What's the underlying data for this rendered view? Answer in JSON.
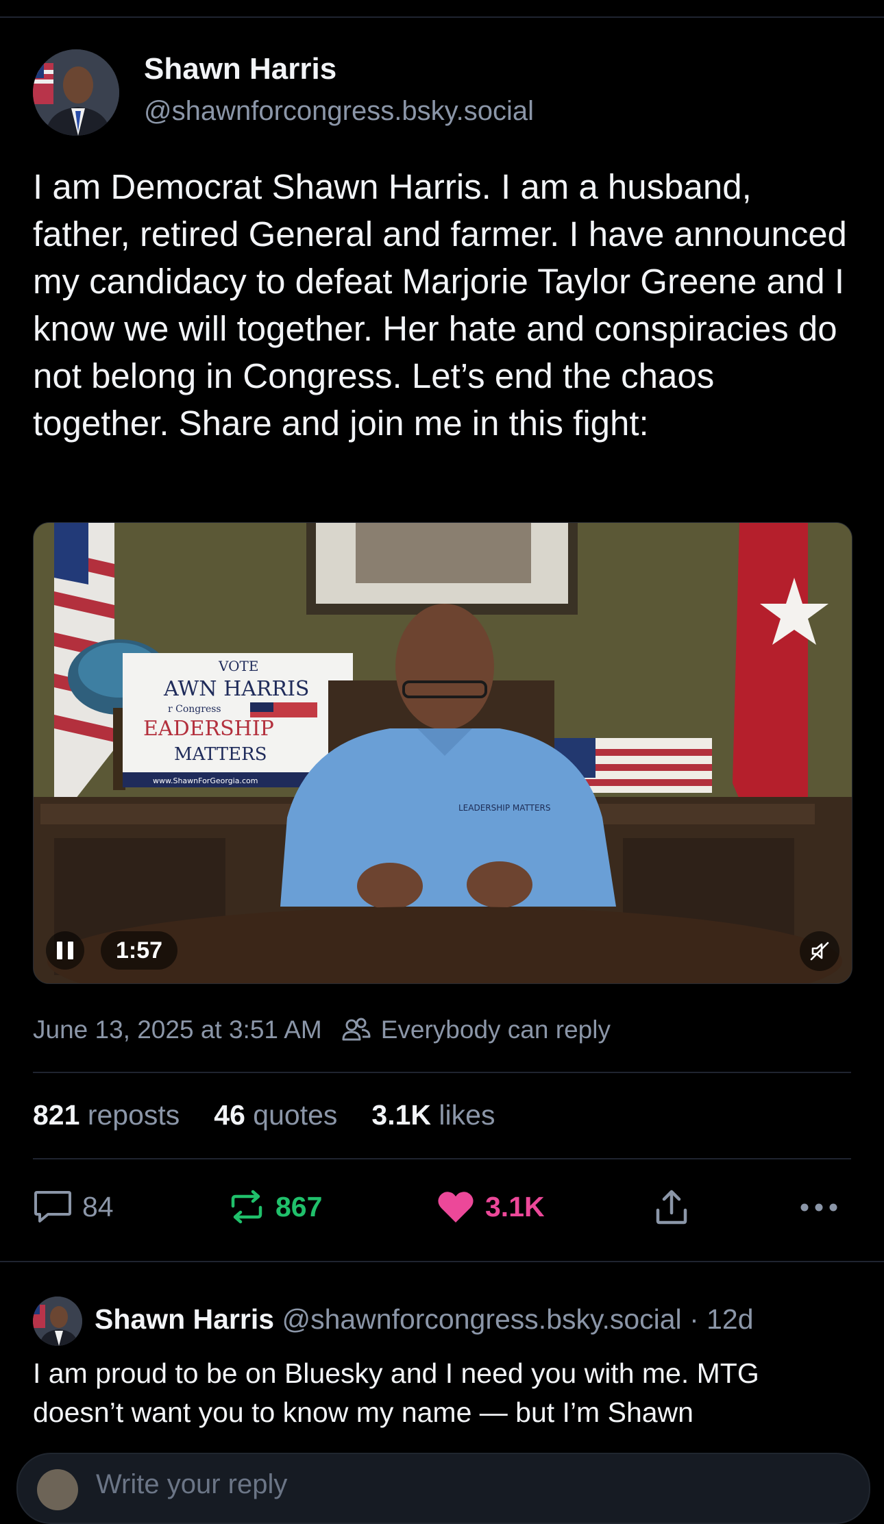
{
  "post": {
    "author_name": "Shawn Harris",
    "author_handle": "@shawnforcongress.bsky.social",
    "text": "I am Democrat Shawn Harris. I am a husband, father, retired General and farmer. I have announced my candidacy to defeat Marjorie Taylor Greene and I know we will together. Her hate and conspiracies do not belong in Congress. Let’s end the chaos together. Share and join me in this fight:",
    "video": {
      "duration": "1:57",
      "sign_lines": [
        "VOTE",
        "AWN HARRIS",
        "r Congress",
        "EADERSHIP",
        "MATTERS",
        "www.ShawnForGeorgia.com"
      ],
      "shirt_logo": "LEADERSHIP MATTERS"
    },
    "timestamp": "June 13, 2025 at 3:51 AM",
    "reply_setting": "Everybody can reply",
    "stats": {
      "reposts_count": "821",
      "reposts_label": "reposts",
      "quotes_count": "46",
      "quotes_label": "quotes",
      "likes_count": "3.1K",
      "likes_label": "likes"
    },
    "actions": {
      "replies": "84",
      "reposts": "867",
      "likes": "3.1K"
    }
  },
  "reply": {
    "author_name": "Shawn Harris",
    "author_handle": "@shawnforcongress.bsky.social",
    "age": "· 12d",
    "text": "I am proud to be on Bluesky and I need you with me. MTG doesn’t want you to know my name — but I’m Shawn"
  },
  "composer": {
    "placeholder": "Write your reply"
  },
  "colors": {
    "background": "#000000",
    "muted_text": "#8b96a8",
    "repost_active": "#20c06b",
    "like_active": "#ec4899"
  },
  "icons": [
    "pause-icon",
    "mute-icon",
    "people-icon",
    "reply-icon",
    "repost-icon",
    "heart-icon",
    "share-icon",
    "more-icon"
  ]
}
